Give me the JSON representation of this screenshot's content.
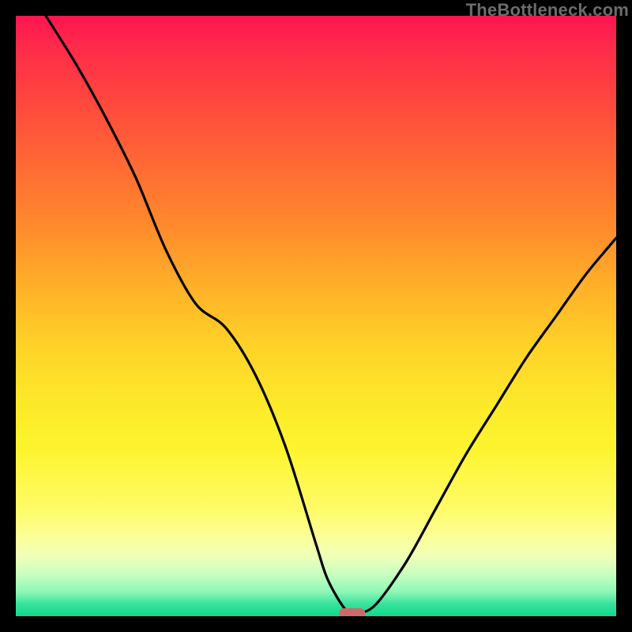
{
  "watermark": "TheBottleneck.com",
  "colors": {
    "frame": "#000000",
    "curve": "#000000",
    "marker": "#cc6a6a",
    "watermark": "#6c6c6c",
    "gradient_stops": [
      "#ff1450",
      "#ff2a4a",
      "#ff4040",
      "#ff6a34",
      "#ff8a2c",
      "#ffb028",
      "#ffd228",
      "#fcea2a",
      "#fdf42e",
      "#fffb66",
      "#fbff9a",
      "#f0ffb8",
      "#c8ffc0",
      "#8cf7b6",
      "#36e39c",
      "#10d98c"
    ]
  },
  "chart_data": {
    "type": "line",
    "title": "",
    "xlabel": "",
    "ylabel": "",
    "xlim": [
      0,
      100
    ],
    "ylim": [
      0,
      100
    ],
    "grid": false,
    "legend": false,
    "note": "Single black curve over red→green vertical gradient; y≈0 at x≈55–58; values are visual estimates (no axis ticks).",
    "x": [
      5,
      10,
      15,
      20,
      25,
      30,
      35,
      40,
      45,
      50,
      52,
      55,
      57,
      60,
      65,
      70,
      75,
      80,
      85,
      90,
      95,
      100
    ],
    "values": [
      100,
      92,
      83,
      73,
      61,
      52,
      48,
      40,
      28,
      12,
      6,
      1,
      0.5,
      2,
      9,
      18,
      27,
      35,
      43,
      50,
      57,
      63
    ],
    "marker": {
      "x": 56,
      "y": 0.5,
      "w_pct": 4.4,
      "h_pct": 1.6
    }
  }
}
